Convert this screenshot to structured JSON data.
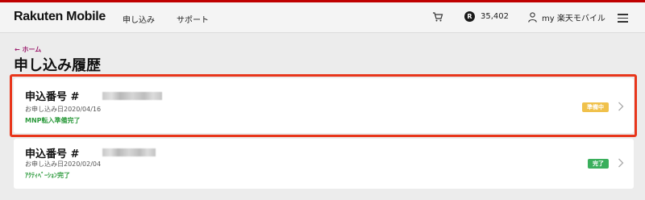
{
  "header": {
    "logo": "Rakuten Mobile",
    "nav": [
      "申し込み",
      "サポート"
    ],
    "points": "35,402",
    "points_badge": "R",
    "account_label": "my 楽天モバイル"
  },
  "breadcrumb": "← ホーム",
  "page_title": "申し込み履歴",
  "orders": [
    {
      "order_label": "申込番号 #",
      "date": "お申し込み日2020/04/16",
      "note": "MNP転入準備完了",
      "status": "準備中",
      "status_color": "#f0c14b"
    },
    {
      "order_label": "申込番号 #",
      "date": "お申し込み日2020/02/04",
      "note": "ｱｸﾃｨﾍﾞｰｼｮﾝ完了",
      "status": "完了",
      "status_color": "#3aaf5c"
    }
  ],
  "colors": {
    "accent": "#bf0000",
    "highlight": "#e8361b",
    "link": "#9a1a6b"
  },
  "icons": [
    "cart-icon",
    "points-icon",
    "user-icon",
    "hamburger-menu-icon",
    "chevron-right-icon"
  ]
}
